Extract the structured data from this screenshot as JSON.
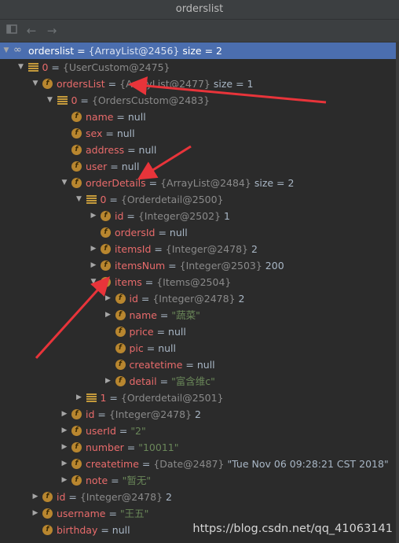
{
  "window": {
    "title": "orderslist"
  },
  "toolbar": {
    "icons": [
      "layout-icon",
      "back-arrow-icon",
      "forward-arrow-icon"
    ]
  },
  "tree": [
    {
      "depth": 0,
      "toggle": "open",
      "icon": "infinity",
      "name": "orderslist",
      "ref": "{ArrayList@2456}",
      "value": "size = 2",
      "selected": true
    },
    {
      "depth": 1,
      "toggle": "open",
      "icon": "array",
      "name": "0",
      "ref": "{UserCustom@2475}",
      "value": ""
    },
    {
      "depth": 2,
      "toggle": "open",
      "icon": "field",
      "name": "ordersList",
      "ref": "{ArrayList@2477}",
      "value": "size = 1"
    },
    {
      "depth": 3,
      "toggle": "open",
      "icon": "array",
      "name": "0",
      "ref": "{OrdersCustom@2483}",
      "value": ""
    },
    {
      "depth": 4,
      "toggle": "none",
      "icon": "field",
      "name": "name",
      "ref": "",
      "value": "null"
    },
    {
      "depth": 4,
      "toggle": "none",
      "icon": "field",
      "name": "sex",
      "ref": "",
      "value": "null"
    },
    {
      "depth": 4,
      "toggle": "none",
      "icon": "field",
      "name": "address",
      "ref": "",
      "value": "null"
    },
    {
      "depth": 4,
      "toggle": "none",
      "icon": "field",
      "name": "user",
      "ref": "",
      "value": "null"
    },
    {
      "depth": 4,
      "toggle": "open",
      "icon": "field",
      "name": "orderDetails",
      "ref": "{ArrayList@2484}",
      "value": "size = 2"
    },
    {
      "depth": 5,
      "toggle": "open",
      "icon": "array",
      "name": "0",
      "ref": "{Orderdetail@2500}",
      "value": ""
    },
    {
      "depth": 6,
      "toggle": "closed",
      "icon": "field",
      "name": "id",
      "ref": "{Integer@2502}",
      "value": "1"
    },
    {
      "depth": 6,
      "toggle": "none",
      "icon": "field",
      "name": "ordersId",
      "ref": "",
      "value": "null"
    },
    {
      "depth": 6,
      "toggle": "closed",
      "icon": "field",
      "name": "itemsId",
      "ref": "{Integer@2478}",
      "value": "2"
    },
    {
      "depth": 6,
      "toggle": "closed",
      "icon": "field",
      "name": "itemsNum",
      "ref": "{Integer@2503}",
      "value": "200"
    },
    {
      "depth": 6,
      "toggle": "open",
      "icon": "field",
      "name": "items",
      "ref": "{Items@2504}",
      "value": ""
    },
    {
      "depth": 7,
      "toggle": "closed",
      "icon": "field",
      "name": "id",
      "ref": "{Integer@2478}",
      "value": "2"
    },
    {
      "depth": 7,
      "toggle": "closed",
      "icon": "field",
      "name": "name",
      "ref": "",
      "value": "\"蔬菜\"",
      "string": true
    },
    {
      "depth": 7,
      "toggle": "none",
      "icon": "field",
      "name": "price",
      "ref": "",
      "value": "null"
    },
    {
      "depth": 7,
      "toggle": "none",
      "icon": "field",
      "name": "pic",
      "ref": "",
      "value": "null"
    },
    {
      "depth": 7,
      "toggle": "none",
      "icon": "field",
      "name": "createtime",
      "ref": "",
      "value": "null"
    },
    {
      "depth": 7,
      "toggle": "closed",
      "icon": "field",
      "name": "detail",
      "ref": "",
      "value": "\"富含维c\"",
      "string": true
    },
    {
      "depth": 5,
      "toggle": "closed",
      "icon": "array",
      "name": "1",
      "ref": "{Orderdetail@2501}",
      "value": ""
    },
    {
      "depth": 4,
      "toggle": "closed",
      "icon": "field",
      "name": "id",
      "ref": "{Integer@2478}",
      "value": "2"
    },
    {
      "depth": 4,
      "toggle": "closed",
      "icon": "field",
      "name": "userId",
      "ref": "",
      "value": "\"2\"",
      "string": true
    },
    {
      "depth": 4,
      "toggle": "closed",
      "icon": "field",
      "name": "number",
      "ref": "",
      "value": "\"10011\"",
      "string": true
    },
    {
      "depth": 4,
      "toggle": "closed",
      "icon": "field",
      "name": "createtime",
      "ref": "{Date@2487}",
      "value": "\"Tue Nov 06 09:28:21 CST 2018\""
    },
    {
      "depth": 4,
      "toggle": "closed",
      "icon": "field",
      "name": "note",
      "ref": "",
      "value": "\"暂无\"",
      "string": true
    },
    {
      "depth": 2,
      "toggle": "closed",
      "icon": "field",
      "name": "id",
      "ref": "{Integer@2478}",
      "value": "2"
    },
    {
      "depth": 2,
      "toggle": "closed",
      "icon": "field",
      "name": "username",
      "ref": "",
      "value": "\"王五\"",
      "string": true
    },
    {
      "depth": 2,
      "toggle": "none",
      "icon": "field",
      "name": "birthday",
      "ref": "",
      "value": "null"
    }
  ],
  "field_icon_letter": "f",
  "watermark": "https://blog.csdn.net/qq_41063141",
  "colors": {
    "annotation_arrow": "#e8343a",
    "selection": "#4b6eaf",
    "field_name": "#e86b6b",
    "string_value": "#6a8759"
  }
}
